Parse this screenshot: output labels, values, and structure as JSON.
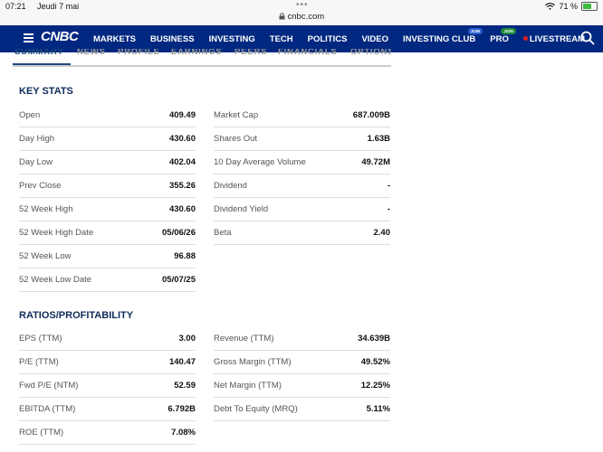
{
  "status_bar": {
    "time": "07:21",
    "date": "Jeudi 7 mai",
    "url": "cnbc.com",
    "battery": "71 %",
    "battery_level": 0.71
  },
  "nav": {
    "logo": "CNBC",
    "items": [
      {
        "label": "MARKETS"
      },
      {
        "label": "BUSINESS"
      },
      {
        "label": "INVESTING"
      },
      {
        "label": "TECH"
      },
      {
        "label": "POLITICS"
      },
      {
        "label": "VIDEO"
      },
      {
        "label": "INVESTING CLUB",
        "badge": "JOIN",
        "badge_color": "#2b5fd0"
      },
      {
        "label": "PRO",
        "badge": "JOIN",
        "badge_color": "#1d8a3c"
      },
      {
        "label": "LIVESTREAM"
      }
    ]
  },
  "tabs": [
    "SUMMARY",
    "NEWS",
    "PROFILE",
    "EARNINGS",
    "PEERS",
    "FINANCIALS",
    "OPTIONS"
  ],
  "key_stats": {
    "title": "KEY STATS",
    "left": [
      {
        "label": "Open",
        "value": "409.49"
      },
      {
        "label": "Day High",
        "value": "430.60"
      },
      {
        "label": "Day Low",
        "value": "402.04"
      },
      {
        "label": "Prev Close",
        "value": "355.26"
      },
      {
        "label": "52 Week High",
        "value": "430.60"
      },
      {
        "label": "52 Week High Date",
        "value": "05/06/26"
      },
      {
        "label": "52 Week Low",
        "value": "96.88"
      },
      {
        "label": "52 Week Low Date",
        "value": "05/07/25"
      }
    ],
    "right": [
      {
        "label": "Market Cap",
        "value": "687.009B"
      },
      {
        "label": "Shares Out",
        "value": "1.63B"
      },
      {
        "label": "10 Day Average Volume",
        "value": "49.72M"
      },
      {
        "label": "Dividend",
        "value": "-"
      },
      {
        "label": "Dividend Yield",
        "value": "-"
      },
      {
        "label": "Beta",
        "value": "2.40"
      }
    ]
  },
  "ratios": {
    "title": "RATIOS/PROFITABILITY",
    "left": [
      {
        "label": "EPS (TTM)",
        "value": "3.00"
      },
      {
        "label": "P/E (TTM)",
        "value": "140.47"
      },
      {
        "label": "Fwd P/E (NTM)",
        "value": "52.59"
      },
      {
        "label": "EBITDA (TTM)",
        "value": "6.792B"
      },
      {
        "label": "ROE (TTM)",
        "value": "7.08%"
      }
    ],
    "right": [
      {
        "label": "Revenue (TTM)",
        "value": "34.639B"
      },
      {
        "label": "Gross Margin (TTM)",
        "value": "49.52%"
      },
      {
        "label": "Net Margin (TTM)",
        "value": "12.25%"
      },
      {
        "label": "Debt To Equity (MRQ)",
        "value": "5.11%"
      }
    ]
  }
}
